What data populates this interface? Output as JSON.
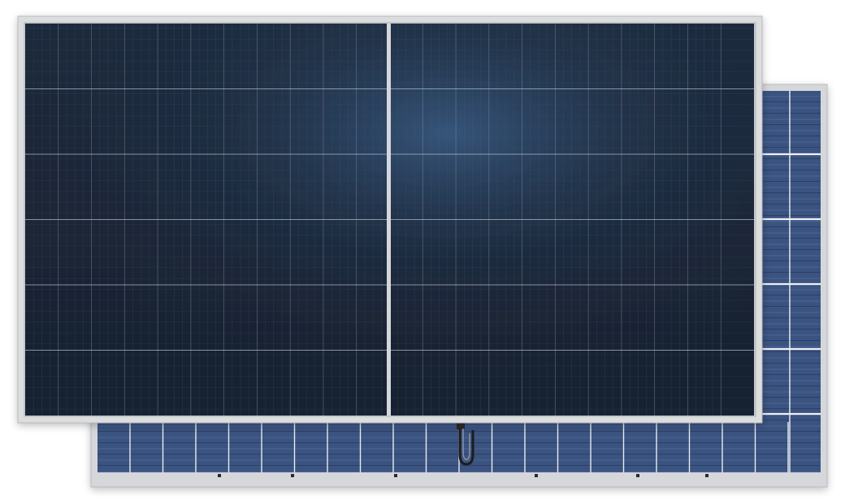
{
  "scene": {
    "subject": "solar-panels",
    "panels": [
      {
        "id": "front-panel",
        "view": "front",
        "cell_columns": 22,
        "cell_rows": 6,
        "halves": 2
      },
      {
        "id": "back-panel",
        "view": "back",
        "has_junction_box": true
      }
    ],
    "colors": {
      "background": "#ffffff",
      "frame": "#d9dadc",
      "frame_edge": "#b9bbbe",
      "cell_dark": "#1a2433",
      "cell_mid": "#22324a",
      "cell_highlight": "#34567e",
      "back_cell": "#3a5280",
      "grid_line": "#8a97a8",
      "split_line": "#d5d7da"
    }
  }
}
